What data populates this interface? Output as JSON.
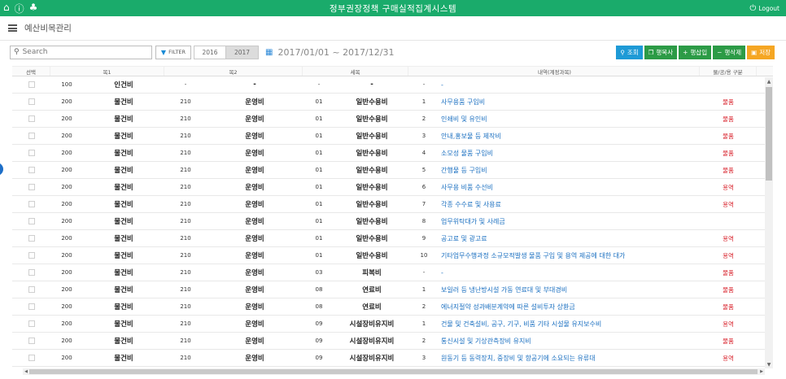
{
  "topbar": {
    "title": "정부권장정책 구매실적집계시스템",
    "logout": "Logout",
    "bg_color": "#1aab6b"
  },
  "header": {
    "page_title": "예산비목관리"
  },
  "toolbar": {
    "search_placeholder": "Search",
    "filter_label": "FILTER",
    "years": [
      "2016",
      "2017"
    ],
    "active_year": "2017",
    "date_range": "2017/01/01 ~ 2017/12/31",
    "actions": {
      "search": "조회",
      "copy_row": "행복사",
      "insert_row": "행삽입",
      "delete_row": "행삭제",
      "save": "저장"
    }
  },
  "grid": {
    "headers": {
      "select": "선택",
      "mok1": "목1",
      "mok2": "목2",
      "semok": "세목",
      "desc": "내역(계정과목)",
      "type": "물/공/용 구분"
    },
    "rows": [
      {
        "c1": "100",
        "n1": "인건비",
        "c2": "-",
        "n2": "-",
        "c3": "-",
        "n3": "-",
        "c4": "-",
        "desc": "-",
        "type": ""
      },
      {
        "c1": "200",
        "n1": "물건비",
        "c2": "210",
        "n2": "운영비",
        "c3": "01",
        "n3": "일반수용비",
        "c4": "1",
        "desc": "사무용품 구입비",
        "type": "물품"
      },
      {
        "c1": "200",
        "n1": "물건비",
        "c2": "210",
        "n2": "운영비",
        "c3": "01",
        "n3": "일반수용비",
        "c4": "2",
        "desc": "인쇄비 및 유인비",
        "type": "물품"
      },
      {
        "c1": "200",
        "n1": "물건비",
        "c2": "210",
        "n2": "운영비",
        "c3": "01",
        "n3": "일반수용비",
        "c4": "3",
        "desc": "안내,홍보물 등 제작비",
        "type": "물품"
      },
      {
        "c1": "200",
        "n1": "물건비",
        "c2": "210",
        "n2": "운영비",
        "c3": "01",
        "n3": "일반수용비",
        "c4": "4",
        "desc": "소모성 물품 구입비",
        "type": "물품"
      },
      {
        "c1": "200",
        "n1": "물건비",
        "c2": "210",
        "n2": "운영비",
        "c3": "01",
        "n3": "일반수용비",
        "c4": "5",
        "desc": "간행물 등 구입비",
        "type": "물품"
      },
      {
        "c1": "200",
        "n1": "물건비",
        "c2": "210",
        "n2": "운영비",
        "c3": "01",
        "n3": "일반수용비",
        "c4": "6",
        "desc": "사무용 비품 수선비",
        "type": "용역"
      },
      {
        "c1": "200",
        "n1": "물건비",
        "c2": "210",
        "n2": "운영비",
        "c3": "01",
        "n3": "일반수용비",
        "c4": "7",
        "desc": "각종 수수료 및 사용료",
        "type": "용역"
      },
      {
        "c1": "200",
        "n1": "물건비",
        "c2": "210",
        "n2": "운영비",
        "c3": "01",
        "n3": "일반수용비",
        "c4": "8",
        "desc": "업무위탁대가 및 사례금",
        "type": ""
      },
      {
        "c1": "200",
        "n1": "물건비",
        "c2": "210",
        "n2": "운영비",
        "c3": "01",
        "n3": "일반수용비",
        "c4": "9",
        "desc": "공고료 및 광고료",
        "type": "용역"
      },
      {
        "c1": "200",
        "n1": "물건비",
        "c2": "210",
        "n2": "운영비",
        "c3": "01",
        "n3": "일반수용비",
        "c4": "10",
        "desc": "기타업무수행과정 소규모적발생 물품 구입 및 용역 제공에 대한 대가",
        "type": "용역"
      },
      {
        "c1": "200",
        "n1": "물건비",
        "c2": "210",
        "n2": "운영비",
        "c3": "03",
        "n3": "피복비",
        "c4": "-",
        "desc": "-",
        "type": "물품"
      },
      {
        "c1": "200",
        "n1": "물건비",
        "c2": "210",
        "n2": "운영비",
        "c3": "08",
        "n3": "연료비",
        "c4": "1",
        "desc": "보일러 등 냉난방시설 가동 연료대 및 부대경비",
        "type": "물품"
      },
      {
        "c1": "200",
        "n1": "물건비",
        "c2": "210",
        "n2": "운영비",
        "c3": "08",
        "n3": "연료비",
        "c4": "2",
        "desc": "에너지절약 성과배분계약에 따른 설비투자 상환금",
        "type": "물품"
      },
      {
        "c1": "200",
        "n1": "물건비",
        "c2": "210",
        "n2": "운영비",
        "c3": "09",
        "n3": "시설장비유지비",
        "c4": "1",
        "desc": "건물 및 건축설비, 공구, 기구, 비품 기타 시설물 유지보수비",
        "type": "용역"
      },
      {
        "c1": "200",
        "n1": "물건비",
        "c2": "210",
        "n2": "운영비",
        "c3": "09",
        "n3": "시설장비유지비",
        "c4": "2",
        "desc": "통신시설 및 기상관측장비 유지비",
        "type": "물품"
      },
      {
        "c1": "200",
        "n1": "물건비",
        "c2": "210",
        "n2": "운영비",
        "c3": "09",
        "n3": "시설장비유지비",
        "c4": "3",
        "desc": "원동기 등 동력장치, 중장비 및 항공기에 소요되는 유류대",
        "type": "용역"
      }
    ]
  }
}
